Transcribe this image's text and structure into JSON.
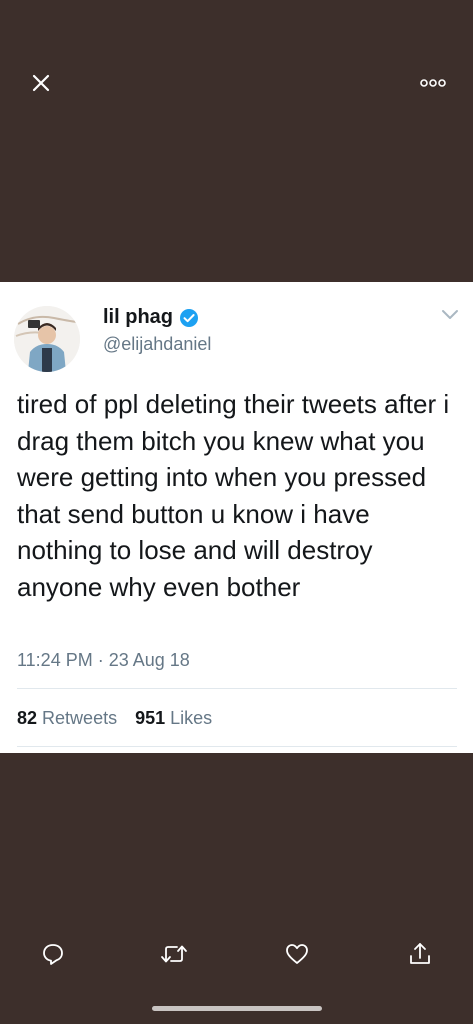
{
  "header": {
    "close_icon": "close-icon",
    "more_icon": "more-options-icon"
  },
  "tweet": {
    "display_name": "lil phag",
    "verified": true,
    "handle": "@elijahdaniel",
    "text": "tired of ppl deleting their tweets after i drag them bitch you knew what you were getting into when you pressed that send button u know i have nothing to lose and will destroy anyone why even bother",
    "timestamp": "11:24 PM · 23 Aug 18",
    "retweet_count": "82",
    "retweet_label": "Retweets",
    "like_count": "951",
    "like_label": "Likes"
  },
  "actions": {
    "reply_icon": "reply-icon",
    "retweet_icon": "retweet-icon",
    "like_icon": "heart-icon",
    "share_icon": "share-icon"
  },
  "colors": {
    "background": "#3d2f2b",
    "card": "#ffffff",
    "text": "#14171a",
    "secondary": "#657786",
    "verified": "#1da1f2"
  }
}
